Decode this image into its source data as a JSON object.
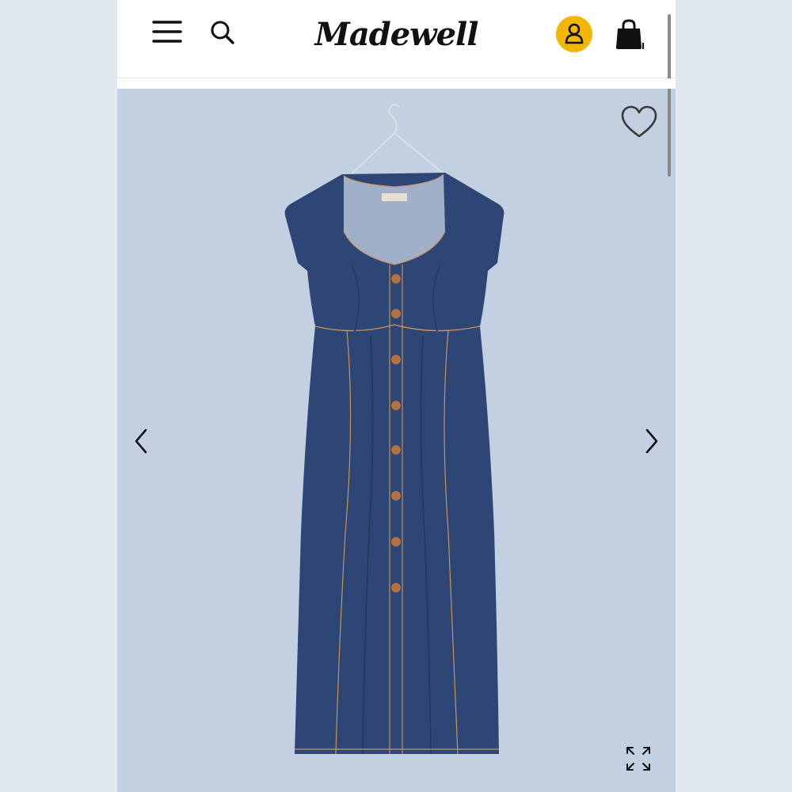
{
  "header": {
    "logo_text": "Madewell",
    "icons": [
      "menu-icon",
      "search-icon",
      "account-icon",
      "shopping-bag-icon"
    ],
    "accent_color": "#f2b705"
  },
  "product_gallery": {
    "image_subject": "dress",
    "icons": [
      "heart-icon",
      "chevron-left-icon",
      "chevron-right-icon",
      "expand-icon"
    ]
  },
  "colors": {
    "denim": "#2d4675",
    "background": "#c3d0e1",
    "stitching": "#c9955a"
  }
}
